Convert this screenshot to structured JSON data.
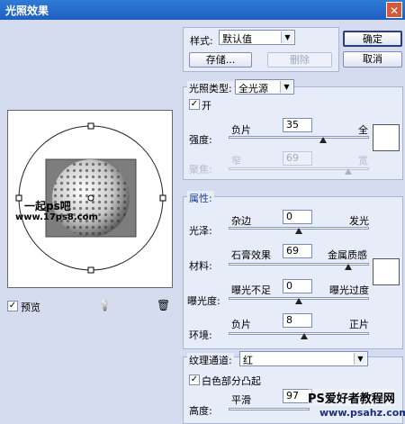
{
  "window": {
    "title": "光照效果",
    "close_glyph": "✕"
  },
  "style": {
    "label": "样式:",
    "value": "默认值",
    "save_label": "存储...",
    "delete_label": "删除"
  },
  "buttons": {
    "ok": "确定",
    "cancel": "取消"
  },
  "light_type": {
    "label": "光照类型:",
    "value": "全光源",
    "on_label": "开",
    "intensity": {
      "label": "强度:",
      "left": "负片",
      "right": "全",
      "value": "35",
      "fraction": 0.67
    },
    "focus": {
      "label": "聚焦:",
      "left": "窄",
      "right": "宽",
      "value": "69",
      "fraction": 0.85
    }
  },
  "properties": {
    "header": "属性:",
    "gloss": {
      "label": "光泽:",
      "left": "杂边",
      "right": "发光",
      "value": "0",
      "fraction": 0.5
    },
    "material": {
      "label": "材料:",
      "left": "石膏效果",
      "right": "金属质感",
      "value": "69",
      "fraction": 0.85
    },
    "exposure": {
      "label": "曝光度:",
      "left": "曝光不足",
      "right": "曝光过度",
      "value": "0",
      "fraction": 0.5
    },
    "ambience": {
      "label": "环境:",
      "left": "负片",
      "right": "正片",
      "value": "8",
      "fraction": 0.54
    }
  },
  "texture": {
    "channel_label": "纹理通道:",
    "channel_value": "红",
    "white_high_label": "白色部分凸起",
    "height": {
      "label": "高度:",
      "left": "平滑",
      "value": "97"
    }
  },
  "preview": {
    "label": "预览",
    "watermark": "一起ps吧",
    "watermark_url": "www.17ps8.com"
  },
  "watermark": {
    "site": "PS爱好者教程网",
    "url": "www.psahz.com"
  },
  "icons": {
    "check": "✓",
    "arrow": "▼",
    "bulb": "💡",
    "trash": "🗑"
  }
}
